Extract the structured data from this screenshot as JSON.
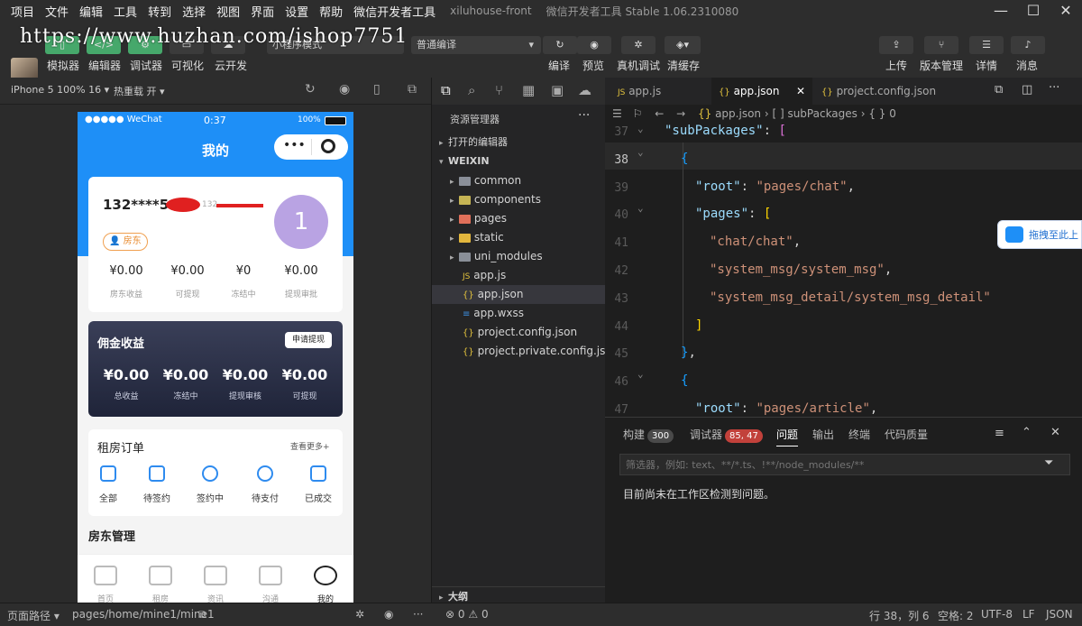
{
  "menu": [
    "项目",
    "文件",
    "编辑",
    "工具",
    "转到",
    "选择",
    "视图",
    "界面",
    "设置",
    "帮助",
    "微信开发者工具"
  ],
  "window": {
    "project": "xiluhouse-front",
    "app_version": "微信开发者工具 Stable 1.06.2310080"
  },
  "watermark": "https://www.huzhan.com/ishop7751",
  "toolbar": {
    "left_labels": [
      "模拟器",
      "编辑器",
      "调试器",
      "可视化",
      "云开发"
    ],
    "mode_select": "小程序模式",
    "compile_select": "普通编译",
    "mid_labels": [
      "编译",
      "预览",
      "真机调试",
      "清缓存"
    ],
    "right_labels": [
      "上传",
      "版本管理",
      "详情",
      "消息"
    ]
  },
  "simulator": {
    "device": "iPhone 5 100% 16",
    "hot_reload": "热重载 开"
  },
  "phone": {
    "status": {
      "carrier": "●●●●● WeChat",
      "time": "0:37",
      "battery": "100%"
    },
    "nav_title": "我的",
    "profile": {
      "phone": "132****5",
      "phone_tail": "132",
      "role": "房东",
      "avatar_text": "1"
    },
    "stats": [
      {
        "value": "¥0.00",
        "label": "房东收益"
      },
      {
        "value": "¥0.00",
        "label": "可提现"
      },
      {
        "value": "¥0",
        "label": "冻结中"
      },
      {
        "value": "¥0.00",
        "label": "提现审批"
      }
    ],
    "commission": {
      "title": "佣金收益",
      "button": "申请提现",
      "stats": [
        {
          "value": "¥0.00",
          "label": "总收益"
        },
        {
          "value": "¥0.00",
          "label": "冻结中"
        },
        {
          "value": "¥0.00",
          "label": "提现审核"
        },
        {
          "value": "¥0.00",
          "label": "可提现"
        }
      ]
    },
    "orders": {
      "title": "租房订单",
      "more": "查看更多+",
      "items": [
        "全部",
        "待签约",
        "签约中",
        "待支付",
        "已成交"
      ]
    },
    "landlord_title": "房东管理",
    "tabbar": [
      "首页",
      "租房",
      "资讯",
      "沟通",
      "我的"
    ]
  },
  "explorer": {
    "title": "资源管理器",
    "open_editors": "打开的编辑器",
    "root": "WEIXIN",
    "items": [
      {
        "name": "common",
        "kind": "folder"
      },
      {
        "name": "components",
        "kind": "folder"
      },
      {
        "name": "pages",
        "kind": "folder"
      },
      {
        "name": "static",
        "kind": "folder"
      },
      {
        "name": "uni_modules",
        "kind": "folder"
      },
      {
        "name": "app.js",
        "kind": "js"
      },
      {
        "name": "app.json",
        "kind": "json"
      },
      {
        "name": "app.wxss",
        "kind": "css"
      },
      {
        "name": "project.config.json",
        "kind": "json"
      },
      {
        "name": "project.private.config.js...",
        "kind": "json"
      }
    ],
    "outline": "大纲"
  },
  "tabs": [
    "app.js",
    "app.json",
    "project.config.json"
  ],
  "breadcrumb": [
    "app.json",
    "[ ] subPackages",
    "{ } 0"
  ],
  "code_lines": [
    {
      "n": "37",
      "tokens": [
        {
          "t": "\"subPackages\"",
          "c": "k"
        },
        {
          "t": ": ",
          "c": ""
        },
        {
          "t": "[",
          "c": "b1"
        }
      ]
    },
    {
      "n": "38",
      "tokens": [
        {
          "t": "{",
          "c": "b3"
        }
      ]
    },
    {
      "n": "39",
      "tokens": [
        {
          "t": "\"root\"",
          "c": "k"
        },
        {
          "t": ": ",
          "c": ""
        },
        {
          "t": "\"pages/chat\"",
          "c": "s"
        },
        {
          "t": ",",
          "c": ""
        }
      ]
    },
    {
      "n": "40",
      "tokens": [
        {
          "t": "\"pages\"",
          "c": "k"
        },
        {
          "t": ": ",
          "c": ""
        },
        {
          "t": "[",
          "c": "b2"
        }
      ]
    },
    {
      "n": "41",
      "tokens": [
        {
          "t": "\"chat/chat\"",
          "c": "s"
        },
        {
          "t": ",",
          "c": ""
        }
      ]
    },
    {
      "n": "42",
      "tokens": [
        {
          "t": "\"system_msg/system_msg\"",
          "c": "s"
        },
        {
          "t": ",",
          "c": ""
        }
      ]
    },
    {
      "n": "43",
      "tokens": [
        {
          "t": "\"system_msg_detail/system_msg_detail\"",
          "c": "s"
        }
      ]
    },
    {
      "n": "44",
      "tokens": [
        {
          "t": "]",
          "c": "b2"
        }
      ]
    },
    {
      "n": "45",
      "tokens": [
        {
          "t": "}",
          "c": "b3"
        },
        {
          "t": ",",
          "c": ""
        }
      ]
    },
    {
      "n": "46",
      "tokens": [
        {
          "t": "{",
          "c": "b3"
        }
      ]
    },
    {
      "n": "47",
      "tokens": [
        {
          "t": "\"root\"",
          "c": "k"
        },
        {
          "t": ": ",
          "c": ""
        },
        {
          "t": "\"pages/article\"",
          "c": "s"
        },
        {
          "t": ",",
          "c": ""
        }
      ]
    }
  ],
  "panel": {
    "tabs": [
      {
        "label": "构建",
        "badge": "300"
      },
      {
        "label": "调试器",
        "badge": "85, 47"
      },
      {
        "label": "问题",
        "badge": ""
      },
      {
        "label": "输出",
        "badge": ""
      },
      {
        "label": "终端",
        "badge": ""
      },
      {
        "label": "代码质量",
        "badge": ""
      }
    ],
    "filter_placeholder": "筛选器，例如: text、**/*.ts、!**/node_modules/**",
    "message": "目前尚未在工作区检测到问题。"
  },
  "drag_tip": "拖拽至此上",
  "status": {
    "path_label": "页面路径",
    "path": "pages/home/mine1/mine1",
    "errors": "0",
    "warnings": "0",
    "cursor": "行 38，列 6",
    "spaces": "空格: 2",
    "encoding": "UTF-8",
    "eol": "LF",
    "lang": "JSON"
  },
  "colors": {
    "accent": "#1e8ff7",
    "green": "#46a86b",
    "badge_red": "#c2413b"
  }
}
